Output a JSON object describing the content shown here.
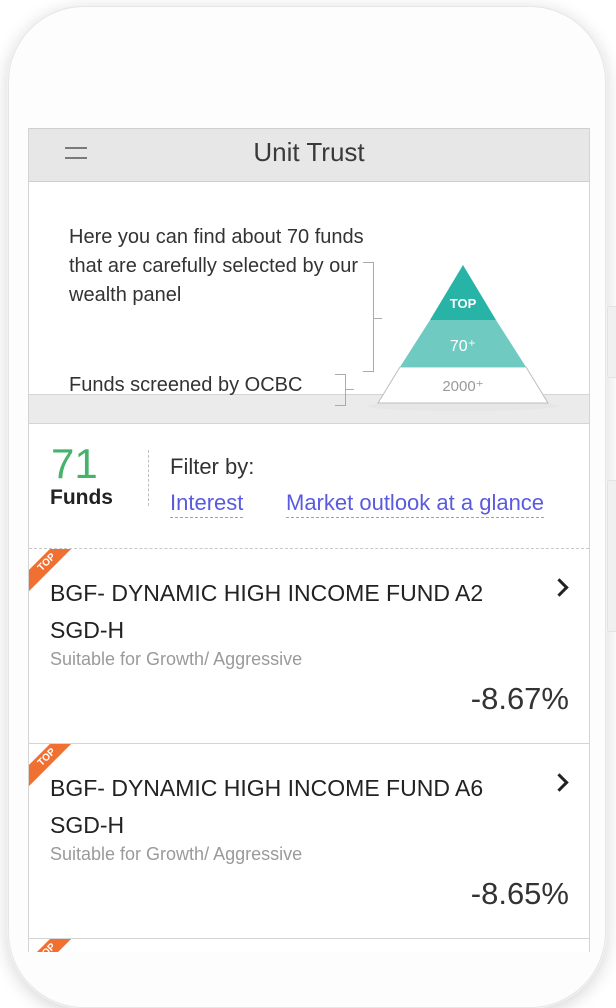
{
  "header": {
    "title": "Unit Trust",
    "menu_icon": "hamburger-icon"
  },
  "intro": {
    "description": "Here you can find about 70 funds that are carefully selected by our wealth panel",
    "screened_label": "Funds screened by OCBC",
    "pyramid": {
      "top_label": "TOP",
      "middle_label": "70⁺",
      "bottom_label": "2000⁺",
      "top_color": "#27b3a6",
      "middle_color": "#6fcbc2"
    }
  },
  "summary": {
    "count": "71",
    "count_label": "Funds",
    "count_color": "#46b36b"
  },
  "filter": {
    "label": "Filter by:",
    "links": [
      "Interest",
      "Market outlook at a glance"
    ],
    "link_color": "#5a5ae0"
  },
  "badge": {
    "label": "TOP",
    "color": "#f07032"
  },
  "funds": [
    {
      "name": "BGF- DYNAMIC HIGH INCOME FUND A2 SGD-H",
      "suitability": "Suitable for Growth/ Aggressive",
      "value": "-8.67%"
    },
    {
      "name": "BGF- DYNAMIC HIGH INCOME FUND A6 SGD-H",
      "suitability": "Suitable for Growth/ Aggressive",
      "value": "-8.65%"
    }
  ]
}
